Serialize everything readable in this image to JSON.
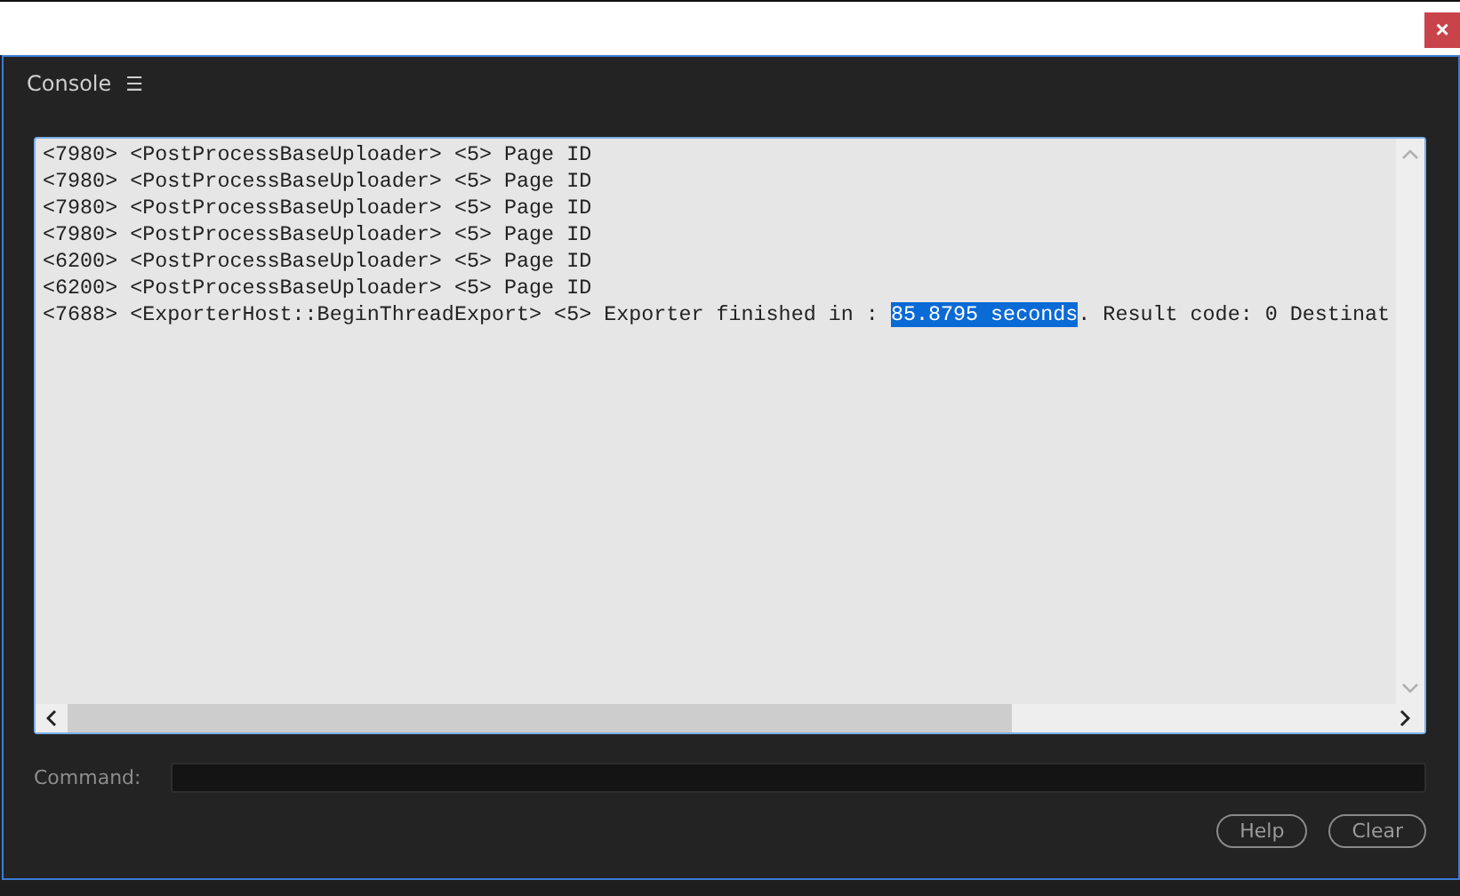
{
  "window": {
    "close_label": "×"
  },
  "panel": {
    "title": "Console",
    "menu_glyph": "☰"
  },
  "log": {
    "lines": [
      {
        "segments": [
          {
            "text": "<7980> <PostProcessBaseUploader> <5> Page ID",
            "selected": false
          }
        ]
      },
      {
        "segments": [
          {
            "text": "<7980> <PostProcessBaseUploader> <5> Page ID",
            "selected": false
          }
        ]
      },
      {
        "segments": [
          {
            "text": "<7980> <PostProcessBaseUploader> <5> Page ID",
            "selected": false
          }
        ]
      },
      {
        "segments": [
          {
            "text": "<7980> <PostProcessBaseUploader> <5> Page ID",
            "selected": false
          }
        ]
      },
      {
        "segments": [
          {
            "text": "<6200> <PostProcessBaseUploader> <5> Page ID",
            "selected": false
          }
        ]
      },
      {
        "segments": [
          {
            "text": "<6200> <PostProcessBaseUploader> <5> Page ID",
            "selected": false
          }
        ]
      },
      {
        "segments": [
          {
            "text": "<7688> <ExporterHost::BeginThreadExport> <5> Exporter finished in : ",
            "selected": false
          },
          {
            "text": "85.8795 seconds",
            "selected": true
          },
          {
            "text": ". Result code: 0 Destinat",
            "selected": false
          }
        ]
      }
    ]
  },
  "command": {
    "label": "Command:"
  },
  "buttons": [
    "Help",
    "Clear"
  ]
}
